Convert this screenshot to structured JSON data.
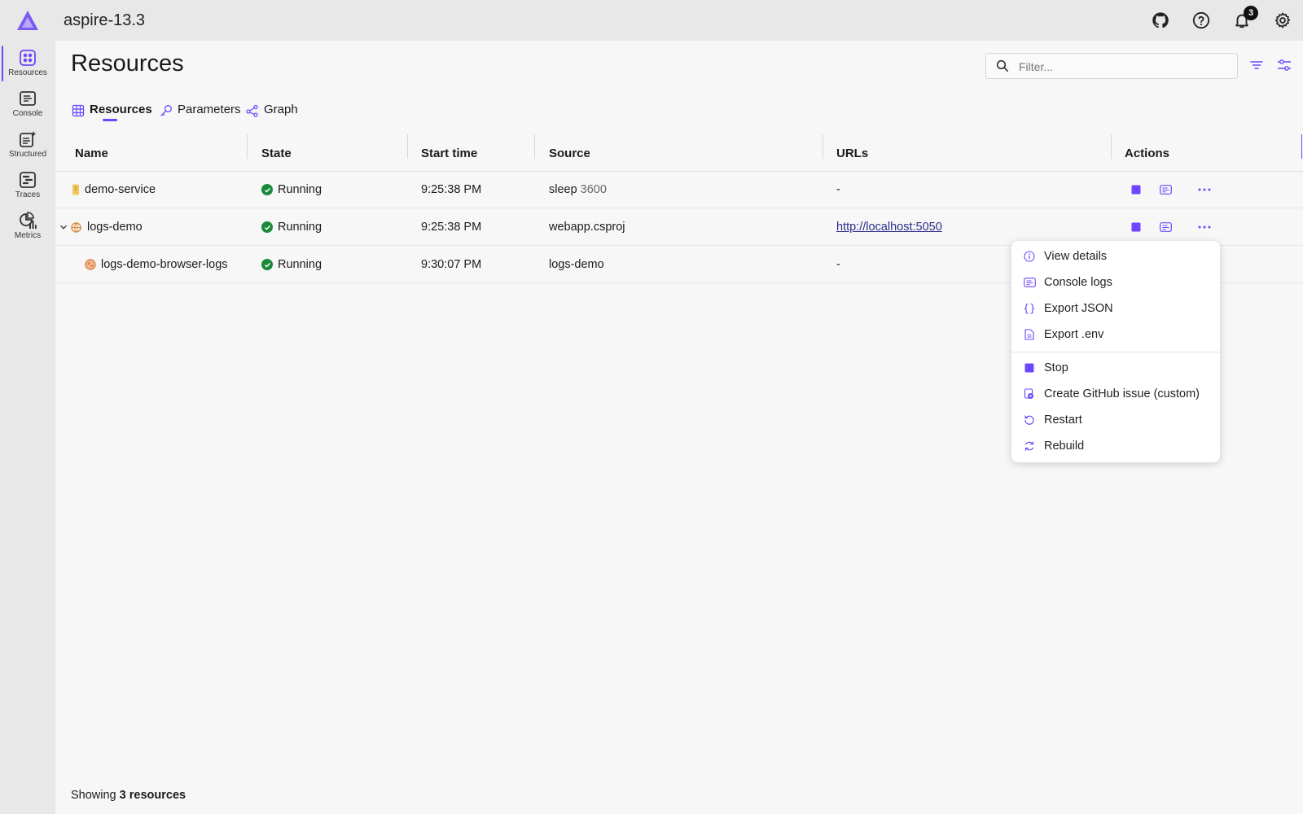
{
  "app": {
    "title": "aspire-13.3",
    "notification_count": "3"
  },
  "sidebar": {
    "items": [
      {
        "label": "Resources",
        "icon": "resources-icon"
      },
      {
        "label": "Console",
        "icon": "console-icon"
      },
      {
        "label": "Structured",
        "icon": "structured-icon"
      },
      {
        "label": "Traces",
        "icon": "traces-icon"
      },
      {
        "label": "Metrics",
        "icon": "metrics-icon"
      }
    ]
  },
  "page": {
    "title": "Resources",
    "filter_placeholder": "Filter..."
  },
  "tabs": [
    {
      "label": "Resources",
      "active": true
    },
    {
      "label": "Parameters",
      "active": false
    },
    {
      "label": "Graph",
      "active": false
    }
  ],
  "grid": {
    "columns": [
      "Name",
      "State",
      "Start time",
      "Source",
      "URLs",
      "Actions"
    ],
    "rows": [
      {
        "name": "demo-service",
        "state": "Running",
        "start_time": "9:25:38 PM",
        "source": "sleep",
        "source_args": "3600",
        "url": "-"
      },
      {
        "name": "logs-demo",
        "state": "Running",
        "start_time": "9:25:38 PM",
        "source": "webapp.csproj",
        "source_args": "",
        "url": "http://localhost:5050"
      },
      {
        "name": "logs-demo-browser-logs",
        "state": "Running",
        "start_time": "9:30:07 PM",
        "source": "logs-demo",
        "source_args": "",
        "url": "-"
      }
    ]
  },
  "context_menu": {
    "items": [
      {
        "label": "View details",
        "icon": "info-icon"
      },
      {
        "label": "Console logs",
        "icon": "console-logs-icon"
      },
      {
        "label": "Export JSON",
        "icon": "braces-icon"
      },
      {
        "label": "Export .env",
        "icon": "document-icon"
      },
      {
        "label": "Stop",
        "icon": "stop-icon"
      },
      {
        "label": "Create GitHub issue (custom)",
        "icon": "github-issue-icon"
      },
      {
        "label": "Restart",
        "icon": "restart-icon"
      },
      {
        "label": "Rebuild",
        "icon": "rebuild-icon"
      }
    ]
  },
  "footer": {
    "prefix": "Showing",
    "count_text": "3 resources"
  },
  "colors": {
    "accent": "#6c47ff",
    "running": "#1a8a3a",
    "header_bg": "#e8e8e8",
    "page_bg": "#f7f7f7"
  }
}
